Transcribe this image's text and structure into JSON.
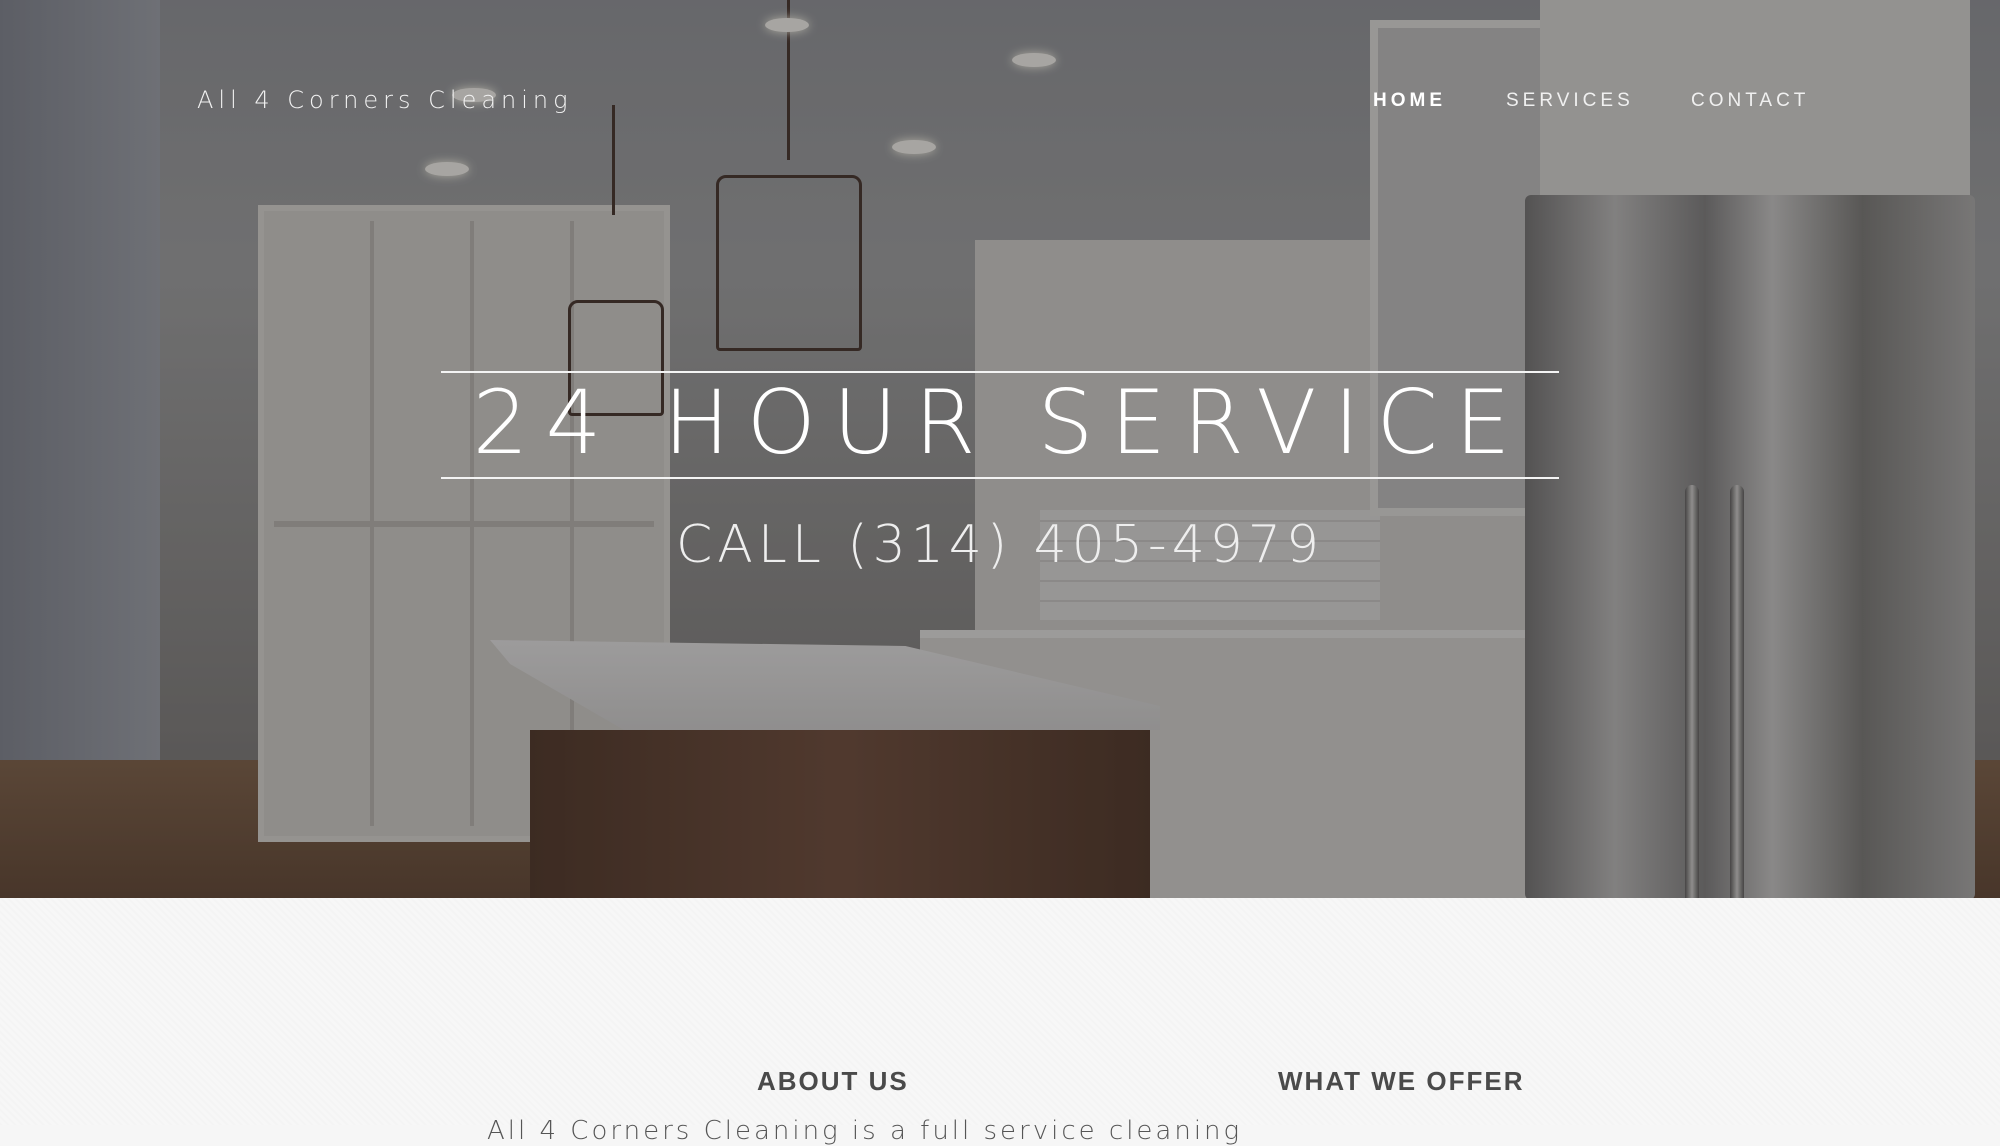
{
  "header": {
    "brand": "All 4 Corners Cleaning",
    "nav": [
      {
        "label": "HOME",
        "active": true
      },
      {
        "label": "SERVICES",
        "active": false
      },
      {
        "label": "CONTACT",
        "active": false
      }
    ]
  },
  "hero": {
    "headline": "24 HOUR SERVICE",
    "phone": "CALL (314) 405-4979",
    "background": "kitchen-photo"
  },
  "sections": {
    "about": {
      "heading": "ABOUT US",
      "text": "All 4 Corners Cleaning is a full service cleaning"
    },
    "offer": {
      "heading": "WHAT WE OFFER"
    }
  },
  "colors": {
    "overlay": "#28282d",
    "text_light": "#ffffff",
    "heading_dark": "#4a4a4a",
    "page_bg": "#f7f7f7"
  }
}
